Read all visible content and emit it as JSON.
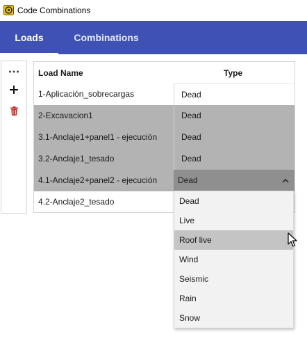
{
  "window": {
    "title": "Code Combinations"
  },
  "tabs": [
    {
      "label": "Loads",
      "active": true
    },
    {
      "label": "Combinations",
      "active": false
    }
  ],
  "toolbar": {
    "more_label": "...",
    "add_label": "+",
    "delete_icon": "trash-icon"
  },
  "grid": {
    "columns": {
      "name": "Load Name",
      "type": "Type"
    },
    "rows": [
      {
        "name": "1-Aplicación_sobrecargas",
        "type": "Dead",
        "state": "normal"
      },
      {
        "name": "2-Excavacion1",
        "type": "Dead",
        "state": "selected"
      },
      {
        "name": "3.1-Anclaje1+panel1 - ejecución",
        "type": "Dead",
        "state": "selected"
      },
      {
        "name": "3.2-Anclaje1_tesado",
        "type": "Dead",
        "state": "selected"
      },
      {
        "name": "4.1-Anclaje2+panel2 - ejecución",
        "type": "Dead",
        "state": "editing"
      },
      {
        "name": "4.2-Anclaje2_tesado",
        "type": "",
        "state": "normal"
      }
    ]
  },
  "dropdown": {
    "options": [
      "Dead",
      "Live",
      "Roof live",
      "Wind",
      "Seismic",
      "Rain",
      "Snow"
    ],
    "hovered": "Roof live"
  },
  "colors": {
    "tab_bar": "#3f51b5",
    "selected_row": "#b3b3b3",
    "editing_cell": "#8f8f8f",
    "dropdown_bg": "#f2f2f2",
    "dropdown_hover": "#c4c4c4",
    "delete_icon": "#c62828"
  }
}
